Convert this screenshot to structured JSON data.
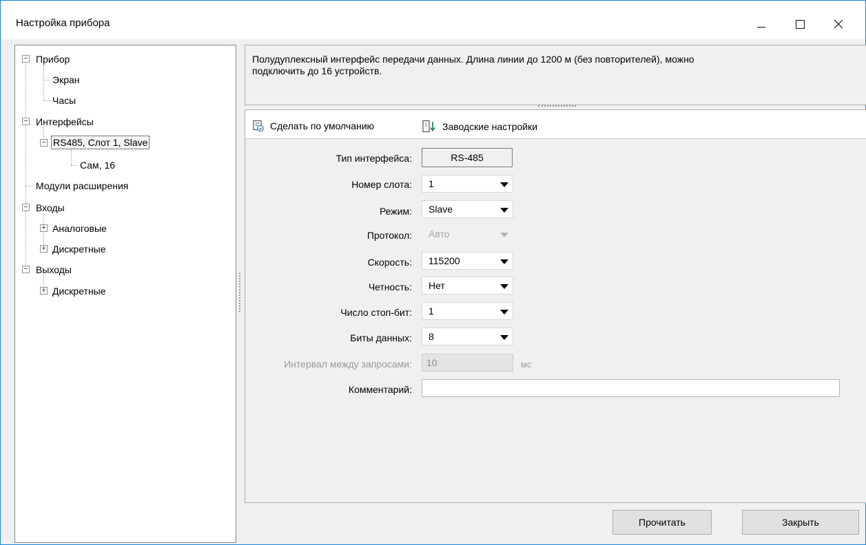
{
  "window": {
    "title": "Настройка прибора",
    "min_icon": "minimize-icon",
    "max_icon": "maximize-icon",
    "close_icon": "close-icon"
  },
  "tree": {
    "items": [
      {
        "label": "Прибор",
        "state": "expanded"
      },
      {
        "label": "Экран"
      },
      {
        "label": "Часы"
      },
      {
        "label": "Интерфейсы",
        "state": "expanded"
      },
      {
        "label": "RS485, Слот 1, Slave",
        "state": "expanded",
        "selected": true
      },
      {
        "label": "Сам, 16"
      },
      {
        "label": "Модули расширения"
      },
      {
        "label": "Входы",
        "state": "expanded"
      },
      {
        "label": "Аналоговые",
        "state": "collapsed"
      },
      {
        "label": "Дискретные",
        "state": "collapsed"
      },
      {
        "label": "Выходы",
        "state": "expanded"
      },
      {
        "label": "Дискретные",
        "state": "collapsed"
      }
    ]
  },
  "description": {
    "line1": "Полудуплексный интерфейс передачи данных. Длина линии до 1200 м (без повторителей), можно",
    "line2": "подключить до 16 устройств."
  },
  "toolbar": {
    "default_label": "Сделать по умолчанию",
    "default_icon": "set-default-icon",
    "factory_label": "Заводские настройки",
    "factory_icon": "factory-reset-icon"
  },
  "form": {
    "interface_type": {
      "label": "Тип интерфейса:",
      "value": "RS-485"
    },
    "slot": {
      "label": "Номер слота:",
      "value": "1"
    },
    "mode": {
      "label": "Режим:",
      "value": "Slave"
    },
    "protocol": {
      "label": "Протокол:",
      "value": "Авто",
      "disabled": true
    },
    "speed": {
      "label": "Скорость:",
      "value": "115200"
    },
    "parity": {
      "label": "Четность:",
      "value": "Нет"
    },
    "stop_bits": {
      "label": "Число стоп-бит:",
      "value": "1"
    },
    "data_bits": {
      "label": "Биты данных:",
      "value": "8"
    },
    "interval": {
      "label": "Интервал между запросами:",
      "value": "10",
      "unit": "мс",
      "disabled": true
    },
    "comment": {
      "label": "Комментарий:",
      "value": ""
    }
  },
  "buttons": {
    "read": "Прочитать",
    "close": "Закрыть"
  },
  "colors": {
    "window_border": "#1883d7",
    "panel_bg": "#f0f0f0",
    "factory_icon_accent": "#1e8e5a",
    "default_icon_accent": "#3c7fc0"
  }
}
